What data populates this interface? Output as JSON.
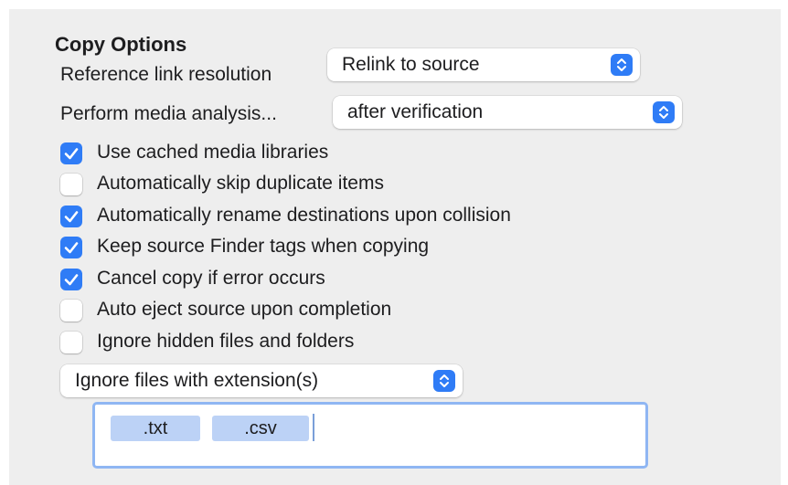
{
  "section": {
    "title": "Copy Options"
  },
  "reference_link": {
    "label": "Reference link resolution",
    "selected": "Relink to source"
  },
  "media_analysis": {
    "label": "Perform media analysis...",
    "selected": "after verification"
  },
  "checkboxes": [
    {
      "label": "Use cached media libraries",
      "checked": true
    },
    {
      "label": "Automatically skip duplicate items",
      "checked": false
    },
    {
      "label": "Automatically rename destinations upon collision",
      "checked": true
    },
    {
      "label": "Keep source Finder tags when copying",
      "checked": true
    },
    {
      "label": "Cancel copy if error occurs",
      "checked": true
    },
    {
      "label": "Auto eject source upon completion",
      "checked": false
    },
    {
      "label": "Ignore hidden files and folders",
      "checked": false
    }
  ],
  "ignore_files": {
    "selected": "Ignore files with extension(s)",
    "extensions": [
      ".txt",
      ".csv"
    ]
  },
  "colors": {
    "accent": "#2f7cf6",
    "token_bg": "#bcd2f6",
    "focus_ring": "#8fb6f3",
    "panel_bg": "#eeeeee"
  }
}
